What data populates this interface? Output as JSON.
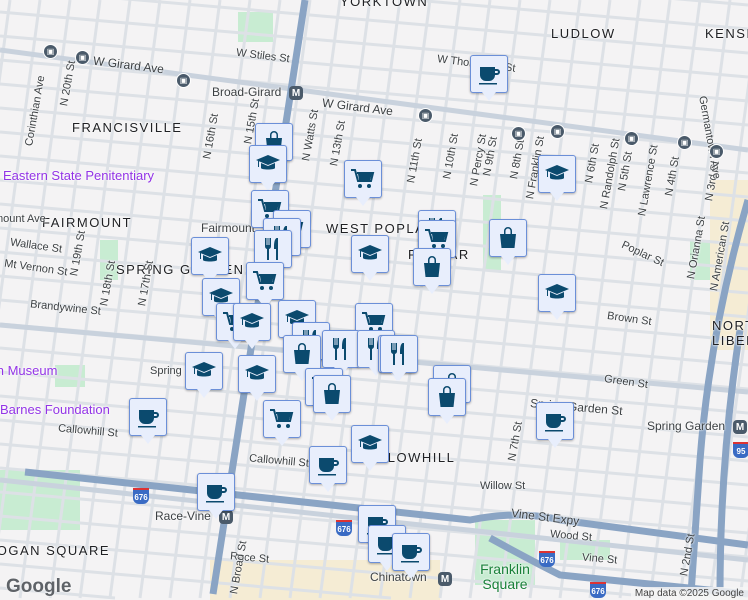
{
  "neighborhoods": [
    "YORKTOWN",
    "LUDLOW",
    "KENSI",
    "FRANCISVILLE",
    "FAIRMOUNT",
    "WEST POPLAR",
    "SPRING GARDEN",
    "POPLAR",
    "CALLOWHILL",
    "NORTH LIBERTIES",
    "LOGAN SQUARE"
  ],
  "pois": [
    "Eastern State Penitentiary",
    "Barnes Foundation",
    "Rodin Museum",
    "Spring Garden",
    "Franklin Square"
  ],
  "streets": [
    "W Girard Ave",
    "W Girard Ave",
    "W Stiles St",
    "W Thompson St",
    "Corinthian Ave",
    "N 20th St",
    "N 16th St",
    "N 15th St",
    "N 13th St",
    "N Watts St",
    "N 11th St",
    "N 10th St",
    "N 9th St",
    "N Percy St",
    "N 8th St",
    "N Franklin St",
    "N 6th St",
    "N Randolph St",
    "N 5th St",
    "N Lawrence St",
    "N 4th St",
    "N Orianna St",
    "N 3rd St",
    "Germantown Ave",
    "N American St",
    "Poplar St",
    "Brown St",
    "Green St",
    "Spring Garden St",
    "Callowhill St",
    "Callowhill St",
    "Willow St",
    "Vine St Expy",
    "Wood St",
    "Vine St",
    "Race St",
    "Wallace St",
    "Mt Vernon St",
    "Brandywine St",
    "N 18th St",
    "N 17th St",
    "N 19th St",
    "N Broad St",
    "N 2nd St",
    "N 7th St",
    "Fairmount Ave"
  ],
  "transit": {
    "broad_girard": "Broad-Girard",
    "fairmount": "Fairmount",
    "race_vine": "Race-Vine",
    "spring_garden": "Spring Garden",
    "chinatown": "Chinatown",
    "metro_glyph": "M"
  },
  "highways": {
    "i676": "676",
    "i95": "95"
  },
  "markers": [
    "coffee",
    "shopping",
    "school",
    "grocery",
    "school",
    "grocery",
    "grocery",
    "restaurant",
    "restaurant",
    "restaurant",
    "grocery",
    "shopping",
    "school",
    "school",
    "grocery",
    "shopping",
    "school",
    "school",
    "grocery",
    "school",
    "school",
    "grocery",
    "restaurant",
    "restaurant",
    "shopping",
    "restaurant",
    "restaurant",
    "restaurant",
    "shopping",
    "shopping",
    "school",
    "school",
    "grocery",
    "grocery",
    "shopping",
    "coffee",
    "coffee",
    "school",
    "coffee",
    "coffee",
    "coffee",
    "coffee",
    "coffee"
  ],
  "attribution": "Map data ©2025 Google",
  "logo": "Google",
  "colors": {
    "marker_bg": "#e8eefc",
    "marker_icon": "#0b4a6e",
    "marker_border": "#6b8fd8",
    "highway": "#8aa4c4",
    "park": "#c8ecd2"
  }
}
